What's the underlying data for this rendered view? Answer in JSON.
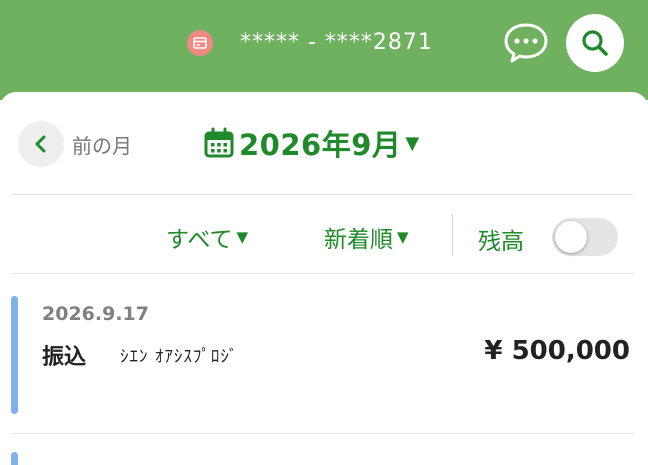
{
  "header": {
    "account_number": "***** - ****2871",
    "account_icon": "card-icon",
    "chat_icon": "chat-bubble-icon",
    "search_icon": "search-icon",
    "bg_color": "#6fb15f"
  },
  "nav": {
    "prev_icon": "chevron-left-icon",
    "prev_label": "前の月",
    "calendar_icon": "calendar-icon",
    "month_label": "2026年9月",
    "caret": "▼"
  },
  "filters": {
    "type_label": "すべて",
    "sort_label": "新着順",
    "caret": "▼",
    "balance_label": "残高",
    "balance_toggle_on": false
  },
  "transactions": [
    {
      "date": "2026.9.17",
      "type": "振込",
      "description": "ｼｴﾝ ｵｱｼｽﾌﾟﾛｼﾞ",
      "amount": "¥ 500,000"
    }
  ],
  "colors": {
    "accent": "#1f8a2a",
    "header": "#6fb15f",
    "txn_marker": "#7fb1ea"
  }
}
